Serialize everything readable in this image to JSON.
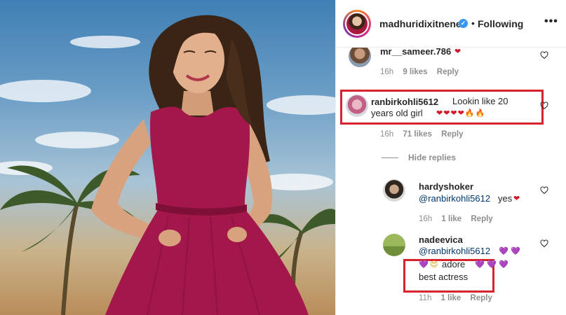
{
  "post": {
    "username": "madhuridixitnene",
    "verified_icon": "verified-badge-icon",
    "separator": "•",
    "follow_status": "Following",
    "more_label": "•••"
  },
  "comments": [
    {
      "username": "mr__sameer.786",
      "text": "❤",
      "time": "16h",
      "likes": "9 likes",
      "reply": "Reply"
    },
    {
      "username": "ranbirkohli5612",
      "text_line1": "Lookin like 20",
      "text_line2": "years old girl",
      "emojis": "❤❤❤❤🔥🔥",
      "time": "16h",
      "likes": "71 likes",
      "reply": "Reply",
      "hide_replies": "Hide replies",
      "replies": [
        {
          "username": "hardyshoker",
          "mention": "@ranbirkohli5612",
          "text": "yes",
          "emoji": "❤",
          "time": "16h",
          "likes": "1 like",
          "reply": "Reply"
        },
        {
          "username": "nadeevica",
          "mention": "@ranbirkohli5612",
          "emoji_line1": "💜 💜",
          "emoji_line2_a": "💜",
          "emoji_line2_b": "😍",
          "text_line2": "adore",
          "emoji_line2_c": "💜 💜 💜",
          "text_line3": "best actress",
          "time": "11h",
          "likes": "1 like",
          "reply": "Reply"
        }
      ]
    }
  ],
  "colors": {
    "highlight_box": "#d6232e",
    "link": "#00376b",
    "meta": "#8e8e8e",
    "verified": "#3897f0"
  }
}
